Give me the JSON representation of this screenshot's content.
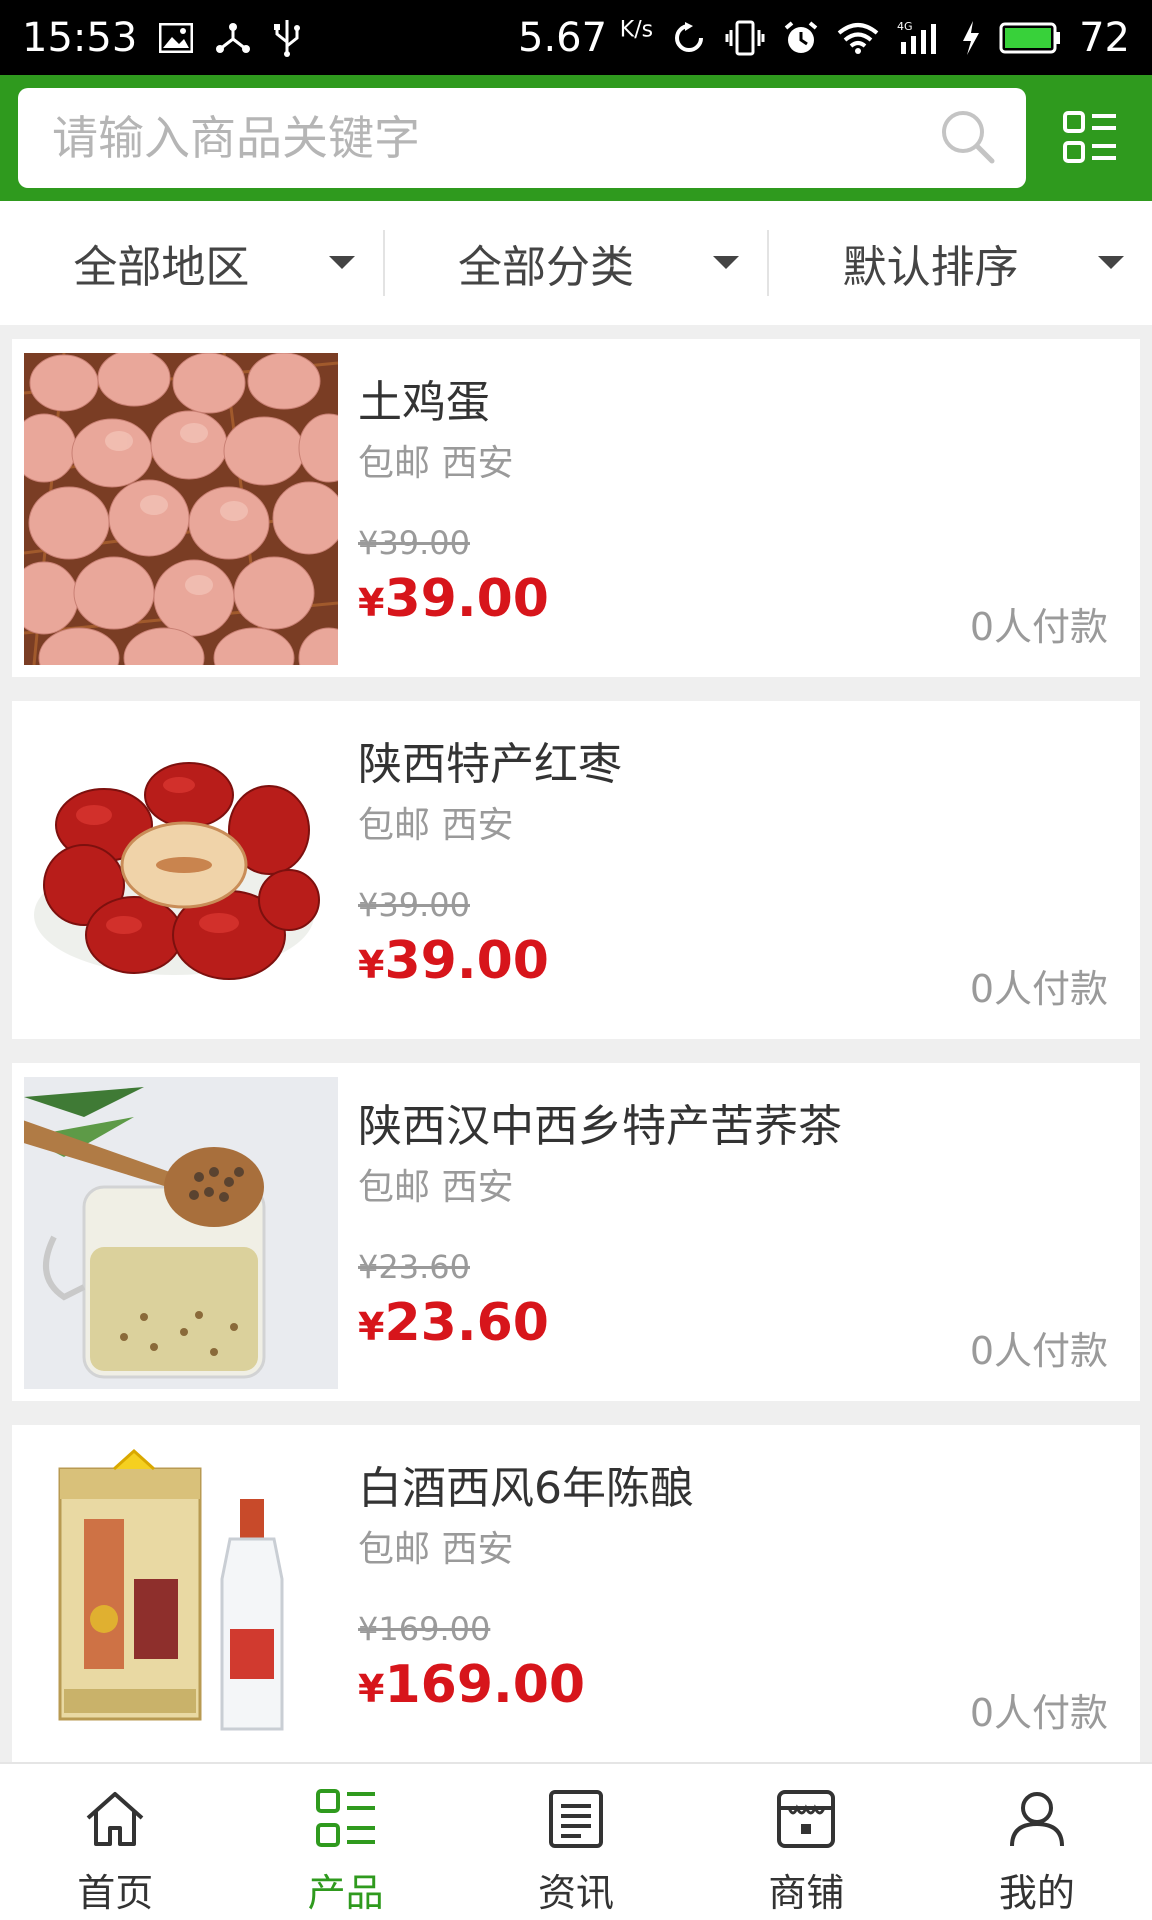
{
  "status_bar": {
    "time": "15:53",
    "speed": "5.67",
    "speed_unit": "K/s",
    "network": "4G",
    "battery": "72"
  },
  "search": {
    "placeholder": "请输入商品关键字"
  },
  "filters": [
    {
      "label": "全部地区"
    },
    {
      "label": "全部分类"
    },
    {
      "label": "默认排序"
    }
  ],
  "products": [
    {
      "name": "土鸡蛋",
      "shipping": "包邮 西安",
      "original_price": "¥39.00",
      "currency": "¥",
      "price": "39.00",
      "paid": "0人付款",
      "image": "eggs"
    },
    {
      "name": "陕西特产红枣",
      "shipping": "包邮 西安",
      "original_price": "¥39.00",
      "currency": "¥",
      "price": "39.00",
      "paid": "0人付款",
      "image": "red-dates"
    },
    {
      "name": "陕西汉中西乡特产苦荞茶",
      "shipping": "包邮 西安",
      "original_price": "¥23.60",
      "currency": "¥",
      "price": "23.60",
      "paid": "0人付款",
      "image": "buckwheat-tea"
    },
    {
      "name": "白酒西风6年陈酿",
      "shipping": "包邮 西安",
      "original_price": "¥169.00",
      "currency": "¥",
      "price": "169.00",
      "paid": "0人付款",
      "image": "liquor"
    }
  ],
  "bottom_nav": [
    {
      "label": "首页",
      "icon": "home-icon",
      "active": false
    },
    {
      "label": "产品",
      "icon": "products-grid-icon",
      "active": true
    },
    {
      "label": "资讯",
      "icon": "news-icon",
      "active": false
    },
    {
      "label": "商铺",
      "icon": "store-icon",
      "active": false
    },
    {
      "label": "我的",
      "icon": "user-icon",
      "active": false
    }
  ],
  "colors": {
    "brand_green": "#2f9a1e",
    "price_red": "#d7151b",
    "muted_text": "#9a9a9a"
  }
}
